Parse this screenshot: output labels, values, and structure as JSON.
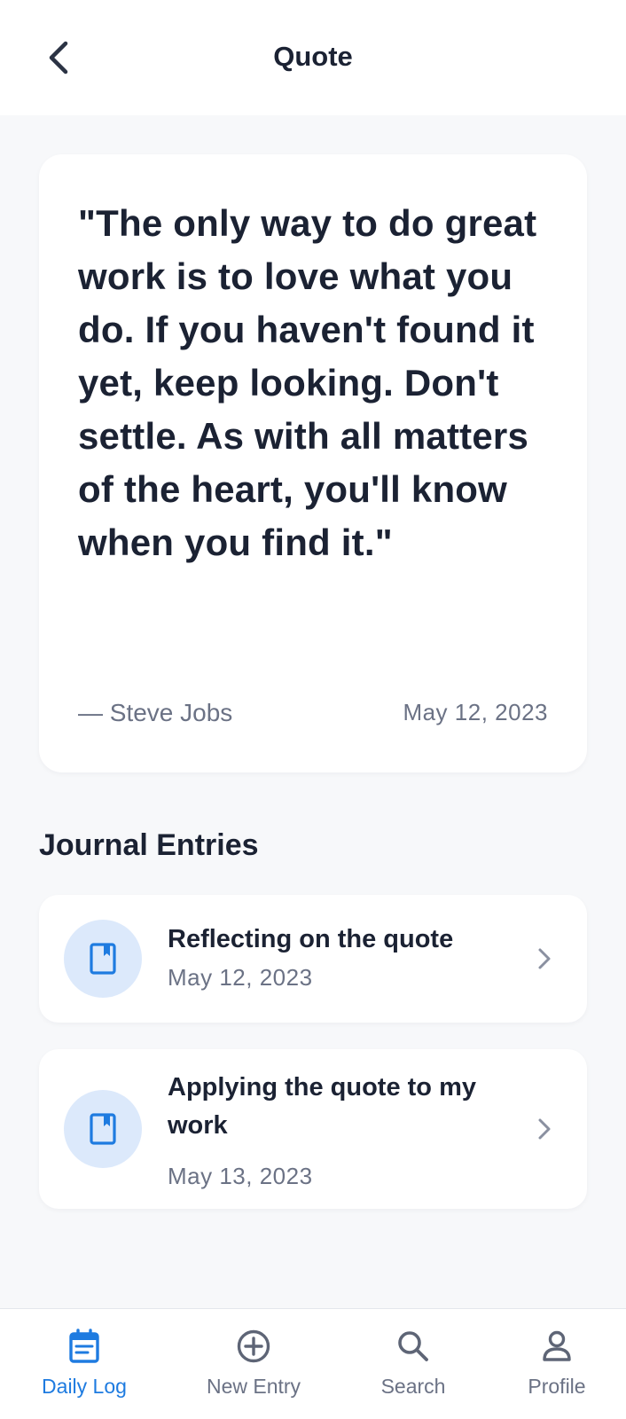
{
  "header": {
    "title": "Quote"
  },
  "quote": {
    "text": "\"The only way to do great work is to love what you do. If you haven't found it yet, keep looking. Don't settle. As with all matters of the heart, you'll know when you find it.\"",
    "author": "— Steve Jobs",
    "date": "May 12, 2023"
  },
  "journal": {
    "section_title": "Journal Entries",
    "entries": [
      {
        "title": "Reflecting on the quote",
        "date": "May 12, 2023",
        "icon": "book-icon"
      },
      {
        "title": "Applying the quote to my work",
        "date": "May 13, 2023",
        "icon": "book-icon"
      }
    ]
  },
  "nav": {
    "items": [
      {
        "label": "Daily Log",
        "icon": "calendar-icon",
        "active": true
      },
      {
        "label": "New Entry",
        "icon": "plus-circle-icon",
        "active": false
      },
      {
        "label": "Search",
        "icon": "search-icon",
        "active": false
      },
      {
        "label": "Profile",
        "icon": "person-icon",
        "active": false
      }
    ]
  },
  "colors": {
    "accent": "#1E7BE0",
    "text_primary": "#1B2233",
    "text_secondary": "#6B7285",
    "background": "#F7F8FA",
    "icon_bubble": "#DCE9FB"
  }
}
